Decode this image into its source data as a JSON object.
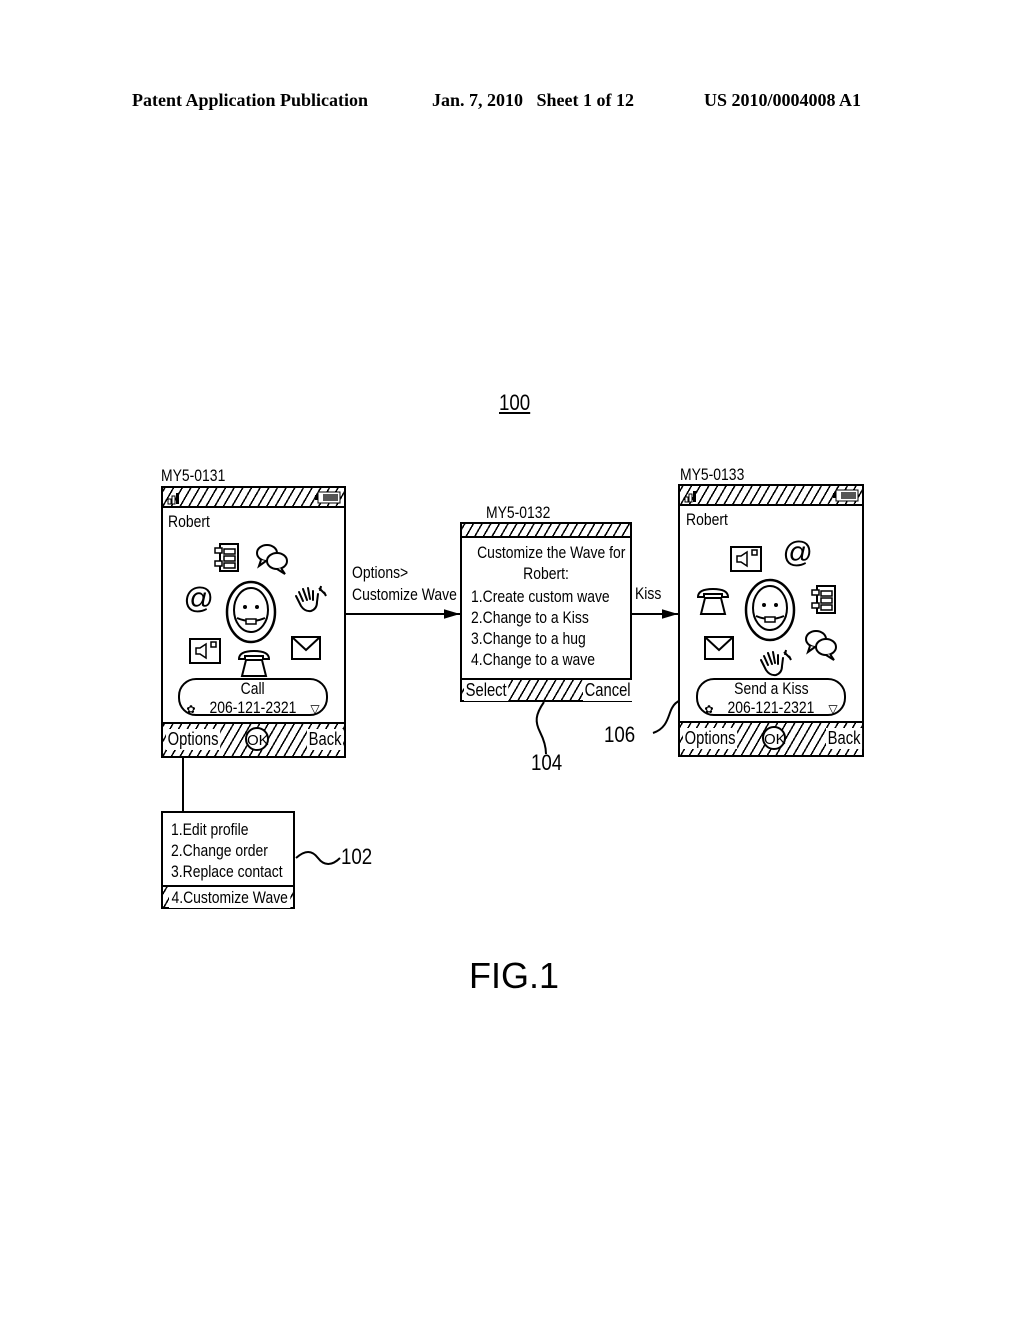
{
  "header": {
    "publication": "Patent Application Publication",
    "date_sheet": "Jan. 7, 2010   Sheet 1 of 12",
    "patent_number": "US 2010/0004008 A1"
  },
  "figure": {
    "reference": "100",
    "caption": "FIG.1"
  },
  "screens": {
    "left": {
      "id": "MY5-0131",
      "contact": "Robert",
      "action_title": "Call",
      "phone_number": "206-121-2321",
      "soft_left": "Options",
      "soft_center": "OK",
      "soft_right": "Back",
      "icons": [
        "address-book-icon",
        "chat-bubbles-icon",
        "at-icon",
        "wave-hand-icon",
        "avatar-face-icon",
        "speaker-card-icon",
        "envelope-icon",
        "telephone-icon"
      ]
    },
    "middle": {
      "id": "MY5-0132",
      "title_line1": "Customize the Wave for",
      "title_line2": "Robert:",
      "items": [
        "1.Create custom wave",
        "2.Change to a Kiss",
        "3.Change to a hug",
        "4.Change to a wave"
      ],
      "soft_left": "Select",
      "soft_right": "Cancel"
    },
    "right": {
      "id": "MY5-0133",
      "contact": "Robert",
      "action_title": "Send a Kiss",
      "phone_number": "206-121-2321",
      "soft_left": "Options",
      "soft_center": "OK",
      "soft_right": "Back",
      "icons": [
        "speaker-card-icon",
        "at-icon",
        "telephone-icon",
        "avatar-face-icon",
        "address-book-icon",
        "envelope-icon",
        "wave-hand-icon",
        "chat-bubbles-icon"
      ]
    }
  },
  "options_menu": {
    "items": [
      "1.Edit profile",
      "2.Change order",
      "3.Replace contact"
    ],
    "selected_item": "4.Customize Wave",
    "reference": "102"
  },
  "transitions": {
    "left_to_middle_line1": "Options>",
    "left_to_middle_line2": "Customize Wave",
    "middle_to_right": "Kiss"
  },
  "callouts": {
    "middle_screen": "104",
    "send_pill": "106"
  }
}
